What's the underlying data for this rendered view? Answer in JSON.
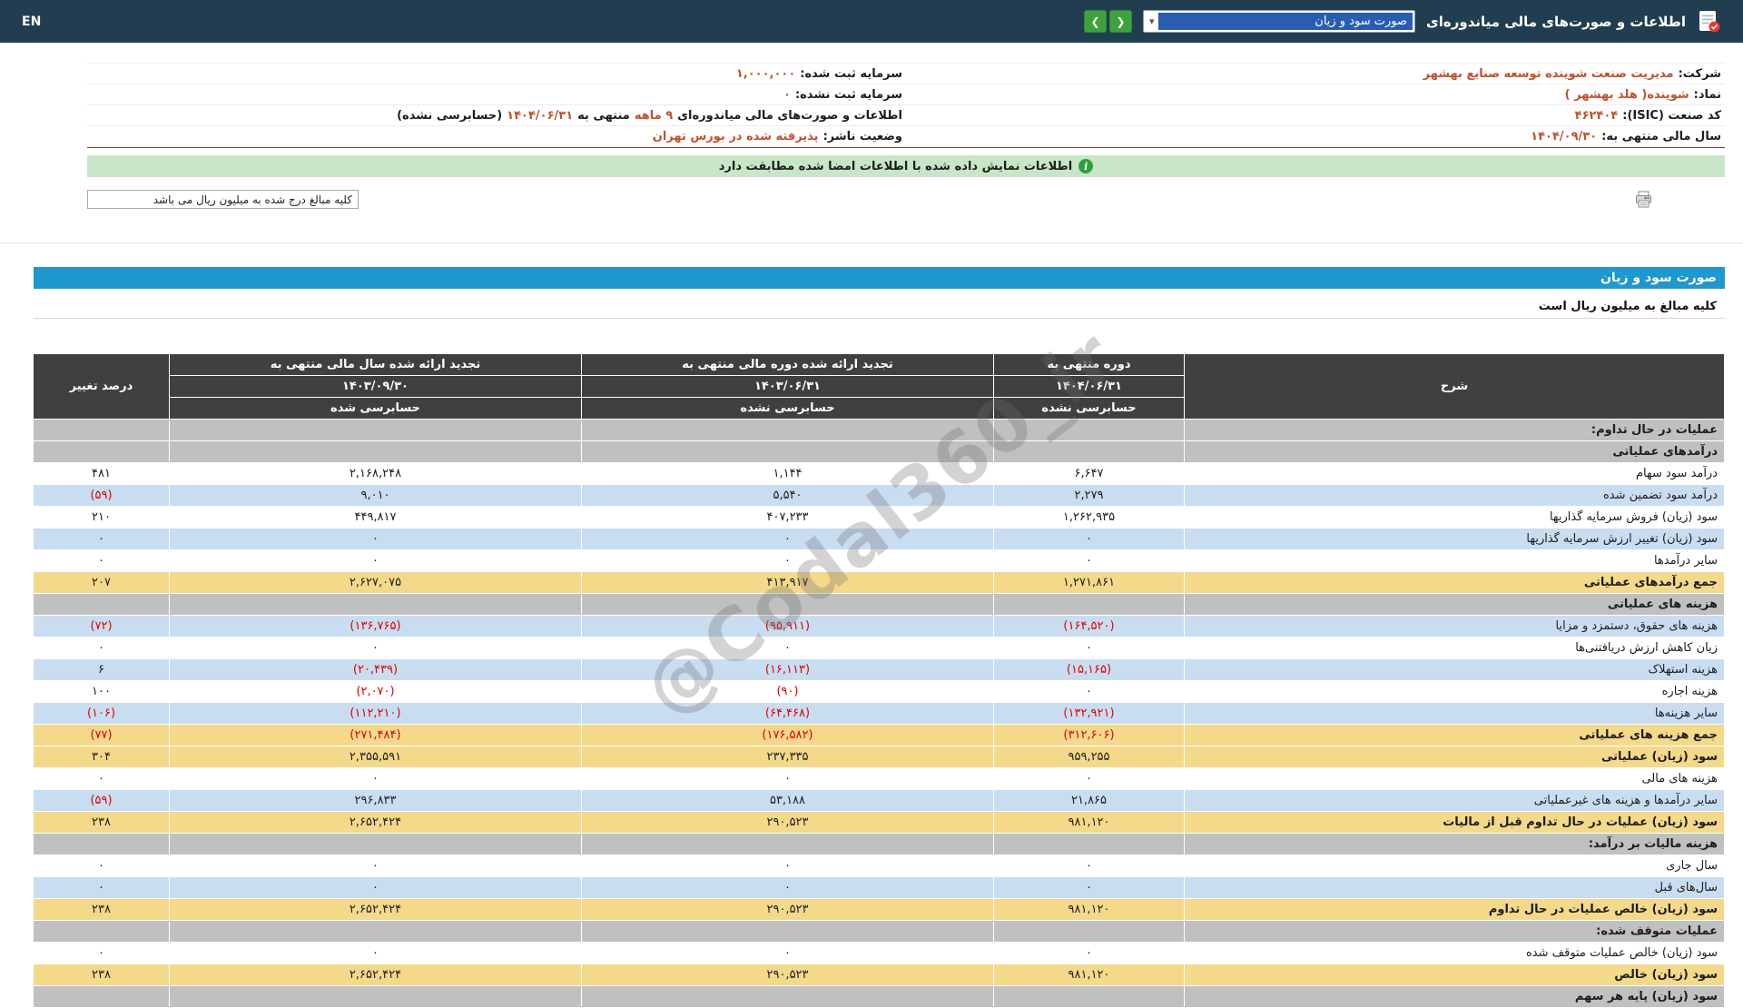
{
  "topbar": {
    "language": "EN",
    "title": "اطلاعات و صورت‌های مالی میاندوره‌ای",
    "report_select_value": "صورت سود و زیان",
    "select_arrow_icon": "▾",
    "nav_right_icon": "❮",
    "nav_left_icon": "❯"
  },
  "info": {
    "company_label": "شرکت:",
    "company_value": "مدیریت صنعت شوینده توسعه صنایع بهشهر",
    "symbol_label": "نماد:",
    "symbol_value": "شوینده( هلد بهشهر )",
    "isic_label": "کد صنعت (ISIC):",
    "isic_value": "۴۶۲۴۰۴",
    "fiscal_year_label": "سال مالی منتهی به:",
    "fiscal_year_value": "۱۴۰۴/۰۹/۳۰",
    "registered_capital_label": "سرمایه ثبت شده:",
    "registered_capital_value": "۱,۰۰۰,۰۰۰",
    "unregistered_capital_label": "سرمایه ثبت نشده:",
    "unregistered_capital_value": "۰",
    "period_prefix": "اطلاعات و صورت‌های مالی میاندوره‌ای",
    "period_length": "۹ ماهه",
    "period_middle": "منتهی به",
    "period_date": "۱۴۰۴/۰۶/۳۱",
    "period_suffix": "(حسابرسی نشده)",
    "status_label": "وضعیت ناشر:",
    "status_value": "پذیرفته شده در بورس تهران"
  },
  "banner": {
    "icon_glyph": "i",
    "text": "اطلاعات نمایش داده شده با اطلاعات امضا شده مطابقت دارد"
  },
  "units_box": {
    "text": "کلیه مبالغ درج شده به میلیون ریال می باشد"
  },
  "statement": {
    "title": "صورت سود و زیان",
    "units_note": "کلیه مبالغ به میلیون ریال است"
  },
  "watermark": {
    "text": "@Codal360_ir"
  },
  "colors": {
    "topbar_bg": "#203e50",
    "statement_title_bg": "#1f97cf",
    "total_row_bg": "#f4d98b",
    "alt_row_bg": "#c9ddf1",
    "section_row_bg": "#c0c0c0",
    "negative_number": "#e00000",
    "info_value_text": "#c0512f",
    "banner_bg": "#c7e6c7",
    "nav_button_bg": "#3fa23f"
  },
  "table": {
    "col_desc": "شرح",
    "col_pct": "درصد تغییر",
    "periods": [
      {
        "title": "دوره منتهی به",
        "date": "۱۴۰۴/۰۶/۳۱",
        "audit": "حسابرسی نشده"
      },
      {
        "title": "تجدید ارائه شده دوره مالی منتهی به",
        "date": "۱۴۰۳/۰۶/۳۱",
        "audit": "حسابرسی نشده"
      },
      {
        "title": "تجدید ارائه شده سال مالی منتهی به",
        "date": "۱۴۰۳/۰۹/۳۰",
        "audit": "حسابرسی شده"
      }
    ],
    "rows": [
      {
        "style": "section",
        "label": "عملیات در حال تداوم:"
      },
      {
        "style": "section",
        "label": "درآمدهای عملیاتی"
      },
      {
        "style": "white",
        "label": "درآمد سود سهام",
        "values": [
          "۶,۶۴۷",
          "۱,۱۴۴",
          "۲,۱۶۸,۲۴۸"
        ],
        "pct": "۴۸۱"
      },
      {
        "style": "blue",
        "label": "درآمد سود تضمین شده",
        "values": [
          "۲,۲۷۹",
          "۵,۵۴۰",
          "۹,۰۱۰"
        ],
        "pct": "(۵۹)"
      },
      {
        "style": "white",
        "label": "سود (زیان) فروش سرمایه گذاریها",
        "values": [
          "۱,۲۶۲,۹۳۵",
          "۴۰۷,۲۳۳",
          "۴۴۹,۸۱۷"
        ],
        "pct": "۲۱۰"
      },
      {
        "style": "blue",
        "label": "سود (زیان) تغییر ارزش سرمایه گذاریها",
        "values": [
          "۰",
          "۰",
          "۰"
        ],
        "pct": "۰"
      },
      {
        "style": "white",
        "label": "سایر درآمدها",
        "values": [
          "۰",
          "۰",
          "۰"
        ],
        "pct": "۰"
      },
      {
        "style": "yellow",
        "label": "جمع درآمدهای عملیاتی",
        "values": [
          "۱,۲۷۱,۸۶۱",
          "۴۱۳,۹۱۷",
          "۲,۶۲۷,۰۷۵"
        ],
        "pct": "۲۰۷"
      },
      {
        "style": "section",
        "label": "هزینه های عملیاتی"
      },
      {
        "style": "blue",
        "label": "هزینه های حقوق، دستمزد و مزایا",
        "values": [
          "(۱۶۴,۵۲۰)",
          "(۹۵,۹۱۱)",
          "(۱۳۶,۷۶۵)"
        ],
        "pct": "(۷۲)"
      },
      {
        "style": "white",
        "label": "زیان کاهش ارزش دریافتنی‌ها",
        "values": [
          "۰",
          "۰",
          "۰"
        ],
        "pct": "۰"
      },
      {
        "style": "blue",
        "label": "هزینه استهلاک",
        "values": [
          "(۱۵,۱۶۵)",
          "(۱۶,۱۱۳)",
          "(۲۰,۴۳۹)"
        ],
        "pct": "۶"
      },
      {
        "style": "white",
        "label": "هزینه اجاره",
        "values": [
          "۰",
          "(۹۰)",
          "(۲,۰۷۰)"
        ],
        "pct": "۱۰۰"
      },
      {
        "style": "blue",
        "label": "سایر هزینه‌ها",
        "values": [
          "(۱۳۲,۹۲۱)",
          "(۶۴,۴۶۸)",
          "(۱۱۲,۲۱۰)"
        ],
        "pct": "(۱۰۶)"
      },
      {
        "style": "yellow",
        "label": "جمع هزینه های عملیاتی",
        "values": [
          "(۳۱۲,۶۰۶)",
          "(۱۷۶,۵۸۲)",
          "(۲۷۱,۴۸۴)"
        ],
        "pct": "(۷۷)"
      },
      {
        "style": "yellow",
        "label": "سود (زیان) عملیاتی",
        "values": [
          "۹۵۹,۲۵۵",
          "۲۳۷,۳۳۵",
          "۲,۳۵۵,۵۹۱"
        ],
        "pct": "۳۰۴"
      },
      {
        "style": "white",
        "label": "هزینه های مالی",
        "values": [
          "۰",
          "۰",
          "۰"
        ],
        "pct": "۰"
      },
      {
        "style": "blue",
        "label": "سایر درآمدها و هزینه های غیرعملیاتی",
        "values": [
          "۲۱,۸۶۵",
          "۵۳,۱۸۸",
          "۲۹۶,۸۳۳"
        ],
        "pct": "(۵۹)"
      },
      {
        "style": "yellow",
        "label": "سود (زیان) عملیات در حال تداوم قبل از مالیات",
        "values": [
          "۹۸۱,۱۲۰",
          "۲۹۰,۵۲۳",
          "۲,۶۵۲,۴۲۴"
        ],
        "pct": "۲۳۸"
      },
      {
        "style": "section",
        "label": "هزینه مالیات بر درآمد:"
      },
      {
        "style": "white",
        "label": "سال جاری",
        "values": [
          "۰",
          "۰",
          "۰"
        ],
        "pct": "۰"
      },
      {
        "style": "blue",
        "label": "سال‌های قبل",
        "values": [
          "۰",
          "۰",
          "۰"
        ],
        "pct": "۰"
      },
      {
        "style": "yellow",
        "label": "سود (زیان) خالص عملیات در حال تداوم",
        "values": [
          "۹۸۱,۱۲۰",
          "۲۹۰,۵۲۳",
          "۲,۶۵۲,۴۲۴"
        ],
        "pct": "۲۳۸"
      },
      {
        "style": "section",
        "label": "عملیات متوقف شده:"
      },
      {
        "style": "white",
        "label": "سود (زیان) خالص عملیات متوقف شده",
        "values": [
          "۰",
          "۰",
          "۰"
        ],
        "pct": "۰"
      },
      {
        "style": "yellow",
        "label": "سود (زیان) خالص",
        "values": [
          "۹۸۱,۱۲۰",
          "۲۹۰,۵۲۳",
          "۲,۶۵۲,۴۲۴"
        ],
        "pct": "۲۳۸"
      },
      {
        "style": "section",
        "label": "سود (زیان) پایه هر سهم"
      }
    ]
  }
}
